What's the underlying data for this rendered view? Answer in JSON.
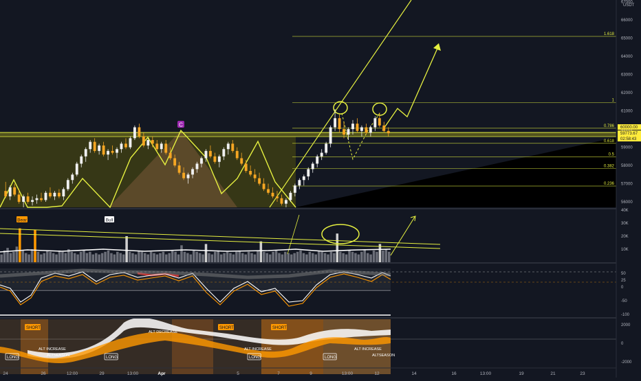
{
  "chart_data": {
    "type": "candlestick",
    "symbol_currency": "USDT",
    "colors": {
      "background": "#131722",
      "bull": "#f0f0f0",
      "bear": "#f5a623",
      "annotation": "#e6f040",
      "fib_line": "#c8d43a",
      "zone_fill": "#5a5a1e",
      "accent_orange": "#ff9800",
      "accent_purple": "#9c27b0"
    },
    "price_axis": {
      "ticks": [
        "67000",
        "66000",
        "65000",
        "64000",
        "63000",
        "62000",
        "61000",
        "60000",
        "59000",
        "58000",
        "57000",
        "56000"
      ],
      "ylim": [
        55700,
        67100
      ],
      "price_tag": "60000.00",
      "last_price": "59773.67",
      "countdown": "02:58:43"
    },
    "fib_levels": [
      {
        "label": "1.618",
        "price": 65100
      },
      {
        "label": "1",
        "price": 61450
      },
      {
        "label": "0.786",
        "price": 60050
      },
      {
        "label": "0.618",
        "price": 59220
      },
      {
        "label": "0.5",
        "price": 58480
      },
      {
        "label": "0.382",
        "price": 57840
      },
      {
        "label": "0.236",
        "price": 56870
      }
    ],
    "x_axis": {
      "labels": [
        "24",
        "26",
        "12:00",
        "29",
        "13:00",
        "Apr",
        "5",
        "7",
        "9",
        "13:00",
        "12",
        "14",
        "16",
        "13:00",
        "19",
        "21",
        "23"
      ],
      "highlight": "Apr"
    },
    "pattern_labels": {
      "peak": "C"
    },
    "volume_panel": {
      "ticks": [
        "40K",
        "30K",
        "20K",
        "10K"
      ],
      "ylim": [
        0,
        40000
      ],
      "labels": [
        "Bear",
        "Bull"
      ],
      "values": [
        6000,
        9000,
        11000,
        7000,
        8000,
        12000,
        26000,
        9000,
        7000,
        6000,
        10000,
        25000,
        8000,
        6000,
        7000,
        9000,
        8000,
        7000,
        6000,
        9000,
        8000,
        7000,
        10000,
        8000,
        7000,
        6000,
        8000,
        9000,
        7000,
        8000,
        6000,
        7000,
        6000,
        7000,
        8000,
        9000,
        7000,
        6000,
        8000,
        7000,
        6000,
        20000,
        8000,
        7000,
        6000,
        9000,
        8000,
        7000,
        6000,
        8000,
        7000,
        6000,
        7000,
        8000,
        6000,
        7000,
        9000,
        8000,
        6000,
        13000,
        8000,
        7000,
        6000,
        9000,
        8000,
        7000,
        6000,
        14000,
        7000,
        6000,
        8000,
        9000,
        6000,
        7000,
        8000,
        7000,
        6000,
        8000,
        9000,
        7000,
        6000,
        8000,
        7000,
        6000,
        9000,
        16000,
        8000,
        7000,
        6000,
        8000,
        9000,
        7000,
        6000,
        8000,
        7000,
        6000,
        7000,
        8000,
        9000,
        7000,
        6000,
        8000,
        7000,
        6000,
        9000,
        8000,
        7000,
        6000,
        8000,
        7000,
        22000,
        8000,
        7000,
        6000,
        9000,
        8000,
        7000,
        6000,
        8000,
        10000,
        7000,
        6000,
        9000,
        8000,
        14000,
        9000,
        10000,
        8000
      ]
    },
    "oscillator_panel": {
      "ticks": [
        "50",
        "25",
        "0",
        "-50",
        "-100"
      ],
      "ylim": [
        -110,
        80
      ]
    },
    "signal_panel": {
      "ticks": [
        "2000",
        "0",
        "-2000"
      ],
      "ylim": [
        -2600,
        2600
      ],
      "signals": [
        "SHORT",
        "ALT DECREASE",
        "SHORT",
        "SHORT",
        "LONG",
        "ALT INCREASE",
        "ALTSEASON",
        "LONG",
        "ALT INCREASE",
        "LONG",
        "LONG",
        "ALT INCREASE",
        "ALTSEASON"
      ]
    },
    "candles": [
      [
        56600,
        57100,
        56200,
        56300
      ],
      [
        56300,
        56900,
        56100,
        56800
      ],
      [
        56800,
        57000,
        56300,
        56400
      ],
      [
        56400,
        56700,
        55900,
        56000
      ],
      [
        56000,
        56400,
        55700,
        56300
      ],
      [
        56300,
        56500,
        55900,
        56000
      ],
      [
        56000,
        56300,
        55800,
        56100
      ],
      [
        56100,
        56400,
        55900,
        56200
      ],
      [
        56200,
        56500,
        56000,
        56100
      ],
      [
        56100,
        56600,
        56000,
        56500
      ],
      [
        56500,
        56800,
        56200,
        56300
      ],
      [
        56300,
        56600,
        56100,
        56500
      ],
      [
        56500,
        56700,
        56200,
        56300
      ],
      [
        56300,
        56800,
        56100,
        56700
      ],
      [
        56700,
        57300,
        56600,
        57200
      ],
      [
        57200,
        57600,
        57000,
        57500
      ],
      [
        57500,
        58200,
        57400,
        58100
      ],
      [
        58100,
        58600,
        57900,
        58500
      ],
      [
        58500,
        59000,
        58200,
        58900
      ],
      [
        58900,
        59400,
        58700,
        59300
      ],
      [
        59300,
        59500,
        58700,
        58800
      ],
      [
        58800,
        59200,
        58600,
        59100
      ],
      [
        59100,
        59300,
        58500,
        58600
      ],
      [
        58600,
        58900,
        58300,
        58800
      ],
      [
        58800,
        59100,
        58600,
        58700
      ],
      [
        58700,
        59000,
        58400,
        58900
      ],
      [
        58900,
        59300,
        58700,
        59200
      ],
      [
        59200,
        59500,
        58900,
        59000
      ],
      [
        59000,
        59600,
        58900,
        59500
      ],
      [
        59500,
        60200,
        59400,
        60100
      ],
      [
        60100,
        60300,
        59500,
        59600
      ],
      [
        59600,
        59800,
        59000,
        59100
      ],
      [
        59100,
        59500,
        58900,
        59400
      ],
      [
        59400,
        59600,
        59000,
        59200
      ],
      [
        59200,
        59400,
        58800,
        58900
      ],
      [
        58900,
        59300,
        58700,
        59200
      ],
      [
        59200,
        59400,
        58600,
        58700
      ],
      [
        58700,
        59000,
        58300,
        58400
      ],
      [
        58400,
        58600,
        57900,
        58000
      ],
      [
        58000,
        58200,
        57500,
        57600
      ],
      [
        57600,
        57900,
        57200,
        57300
      ],
      [
        57300,
        57600,
        57000,
        57500
      ],
      [
        57500,
        57900,
        57300,
        57800
      ],
      [
        57800,
        58200,
        57600,
        58100
      ],
      [
        58100,
        58500,
        57900,
        58400
      ],
      [
        58400,
        58900,
        58200,
        58800
      ],
      [
        58800,
        59100,
        58400,
        58500
      ],
      [
        58500,
        58700,
        58100,
        58200
      ],
      [
        58200,
        58600,
        57900,
        58500
      ],
      [
        58500,
        59000,
        58300,
        58900
      ],
      [
        58900,
        59300,
        58600,
        59200
      ],
      [
        59200,
        59400,
        58700,
        58800
      ],
      [
        58800,
        59000,
        58300,
        58400
      ],
      [
        58400,
        58700,
        58000,
        58100
      ],
      [
        58100,
        58300,
        57600,
        57700
      ],
      [
        57700,
        58000,
        57400,
        57500
      ],
      [
        57500,
        57800,
        57100,
        57300
      ],
      [
        57300,
        57600,
        56900,
        57000
      ],
      [
        57000,
        57300,
        56600,
        56700
      ],
      [
        56700,
        57000,
        56400,
        56500
      ],
      [
        56500,
        56800,
        56200,
        56300
      ],
      [
        56300,
        56600,
        56000,
        56200
      ],
      [
        56200,
        56400,
        55800,
        55900
      ],
      [
        55900,
        56200,
        55700,
        56100
      ],
      [
        56100,
        56600,
        56000,
        56500
      ],
      [
        56500,
        57000,
        56300,
        56900
      ],
      [
        56900,
        57300,
        56700,
        57200
      ],
      [
        57200,
        57500,
        56900,
        57400
      ],
      [
        57400,
        57900,
        57200,
        57800
      ],
      [
        57800,
        58200,
        57600,
        58100
      ],
      [
        58100,
        58600,
        57900,
        58500
      ],
      [
        58500,
        58900,
        58300,
        58700
      ],
      [
        58700,
        59300,
        58600,
        59200
      ],
      [
        59200,
        60200,
        59000,
        60100
      ],
      [
        60100,
        61100,
        59900,
        60600
      ],
      [
        60600,
        60800,
        59800,
        60000
      ],
      [
        60000,
        60400,
        59500,
        59700
      ],
      [
        59700,
        60100,
        59400,
        60000
      ],
      [
        60000,
        60500,
        59700,
        60300
      ],
      [
        60300,
        60600,
        59800,
        59900
      ],
      [
        59900,
        60200,
        59600,
        60100
      ],
      [
        60100,
        60300,
        59700,
        59800
      ],
      [
        59800,
        60200,
        59600,
        60100
      ],
      [
        60100,
        60700,
        59900,
        60600
      ],
      [
        60600,
        60900,
        60100,
        60200
      ],
      [
        60200,
        60400,
        59800,
        59900
      ],
      [
        59900,
        60100,
        59600,
        59773
      ]
    ]
  }
}
